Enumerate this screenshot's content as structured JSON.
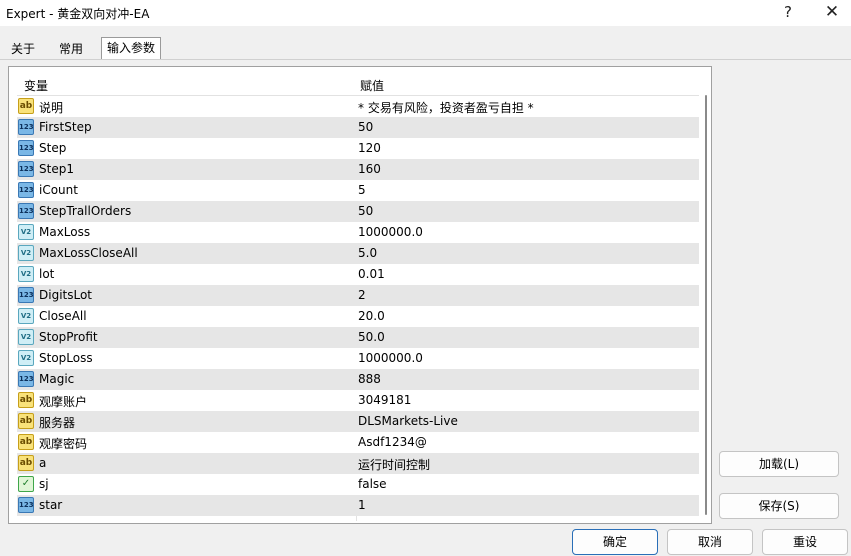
{
  "window": {
    "title": "Expert - 黄金双向对冲-EA",
    "help_icon": "?",
    "close_icon": "✕"
  },
  "tabs": [
    {
      "label": "关于"
    },
    {
      "label": "常用"
    },
    {
      "label": "输入参数"
    }
  ],
  "table": {
    "headers": {
      "variable": "变量",
      "value": "赋值"
    },
    "rows": [
      {
        "icon": "ab",
        "name": "说明",
        "value": "* 交易有风险，投资者盈亏自担 *"
      },
      {
        "icon": "123",
        "name": "FirstStep",
        "value": "50"
      },
      {
        "icon": "123",
        "name": "Step",
        "value": "120"
      },
      {
        "icon": "123",
        "name": "Step1",
        "value": "160"
      },
      {
        "icon": "123",
        "name": "iCount",
        "value": "5"
      },
      {
        "icon": "123",
        "name": "StepTrallOrders",
        "value": "50"
      },
      {
        "icon": "v2",
        "name": "MaxLoss",
        "value": "1000000.0"
      },
      {
        "icon": "v2",
        "name": "MaxLossCloseAll",
        "value": "5.0"
      },
      {
        "icon": "v2",
        "name": "lot",
        "value": "0.01"
      },
      {
        "icon": "123",
        "name": "DigitsLot",
        "value": "2"
      },
      {
        "icon": "v2",
        "name": "CloseAll",
        "value": "20.0"
      },
      {
        "icon": "v2",
        "name": "StopProfit",
        "value": "50.0"
      },
      {
        "icon": "v2",
        "name": "StopLoss",
        "value": "1000000.0"
      },
      {
        "icon": "123",
        "name": "Magic",
        "value": "888"
      },
      {
        "icon": "ab",
        "name": "观摩账户",
        "value": "3049181"
      },
      {
        "icon": "ab",
        "name": "服务器",
        "value": "DLSMarkets-Live"
      },
      {
        "icon": "ab",
        "name": "观摩密码",
        "value": "Asdf1234@"
      },
      {
        "icon": "ab",
        "name": "a",
        "value": "运行时间控制"
      },
      {
        "icon": "bool",
        "name": "sj",
        "value": "false"
      },
      {
        "icon": "123",
        "name": "star",
        "value": "1"
      }
    ]
  },
  "buttons": {
    "load": "加载(L)",
    "save": "保存(S)",
    "ok": "确定",
    "cancel": "取消",
    "reset": "重设"
  }
}
